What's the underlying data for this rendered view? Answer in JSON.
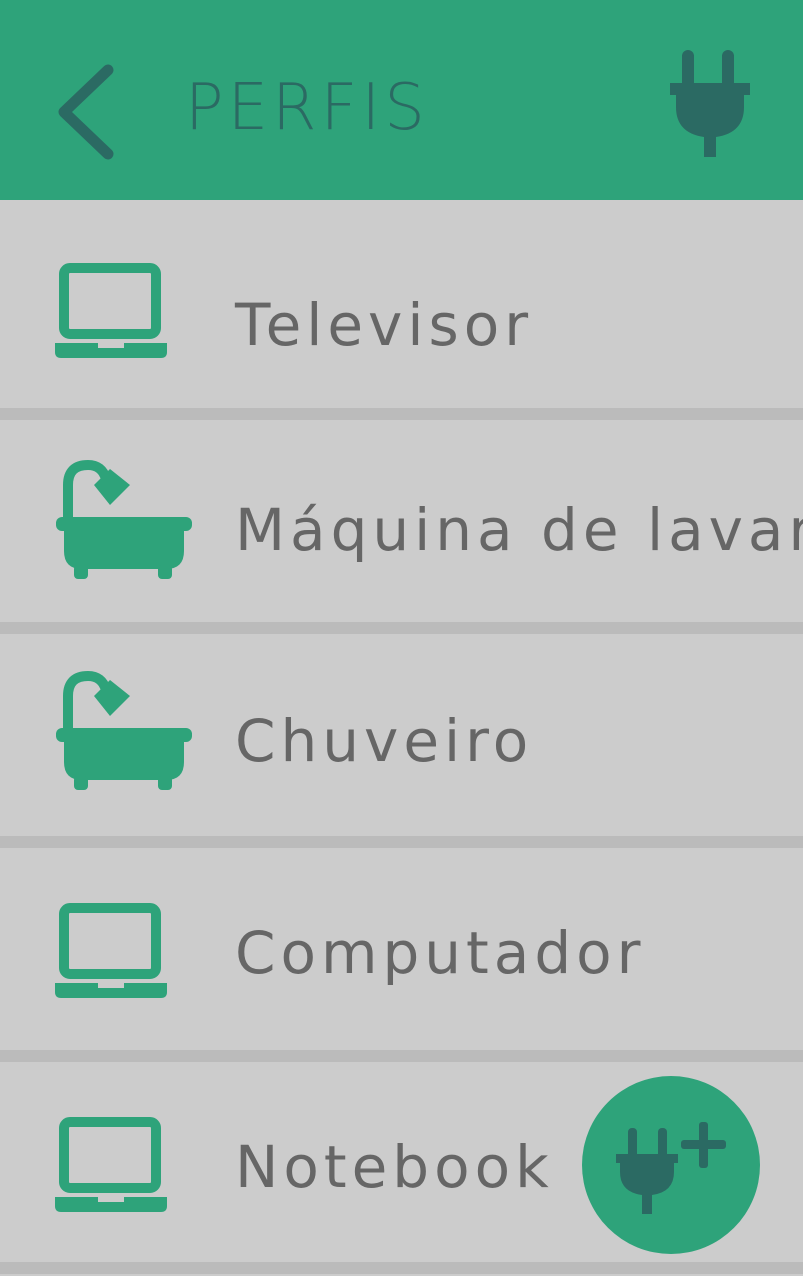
{
  "colors": {
    "accent": "#2ea37a",
    "icon_dark": "#2b6a63",
    "background": "#cccccc",
    "divider": "#bbbbbb",
    "text": "#666666"
  },
  "header": {
    "title": "PERFIS",
    "back_icon": "chevron-left-icon",
    "action_icon": "plug-icon"
  },
  "profiles": [
    {
      "label": "Televisor",
      "icon": "laptop-icon"
    },
    {
      "label": "Máquina de lavar",
      "icon": "bathtub-shower-icon"
    },
    {
      "label": "Chuveiro",
      "icon": "bathtub-shower-icon"
    },
    {
      "label": "Computador",
      "icon": "laptop-icon"
    },
    {
      "label": "Notebook",
      "icon": "laptop-icon"
    }
  ],
  "fab": {
    "icon": "plug-add-icon"
  }
}
